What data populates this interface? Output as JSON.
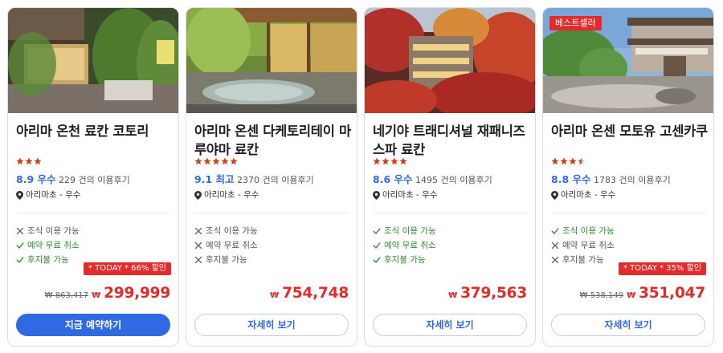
{
  "cards": [
    {
      "badge": "",
      "name": "아리마 온천 료칸 코토리",
      "stars": [
        1,
        1,
        1
      ],
      "score": "8.9 우수",
      "reviews": "229 건의 이용후기",
      "location": "아리마초 - 우수",
      "features": [
        {
          "text": "조식 이용 가능",
          "available": false
        },
        {
          "text": "예약 무료 취소",
          "available": true
        },
        {
          "text": "후지불 가능",
          "available": true
        }
      ],
      "promo": "* TODAY * 66% 할인",
      "old_price": "₩ 863,417",
      "currency": "₩",
      "price": "299,999",
      "button": "지금 예약하기",
      "button_style": "primary"
    },
    {
      "badge": "",
      "name": "아리마 온센 다케토리테이 마루야마 료칸",
      "stars": [
        1,
        1,
        1,
        1,
        1
      ],
      "score": "9.1 최고",
      "reviews": "2370 건의 이용후기",
      "location": "아리마초 - 우수",
      "features": [
        {
          "text": "조식 이용 가능",
          "available": false
        },
        {
          "text": "예약 무료 취소",
          "available": false
        },
        {
          "text": "후지불 가능",
          "available": false
        }
      ],
      "promo": "",
      "old_price": "",
      "currency": "₩",
      "price": "754,748",
      "button": "자세히 보기",
      "button_style": "secondary"
    },
    {
      "badge": "",
      "name": "네기야 트래디셔널 재패니즈 스파 료칸",
      "stars": [
        1,
        1,
        1,
        1
      ],
      "score": "8.6 우수",
      "reviews": "1495 건의 이용후기",
      "location": "아리마초 - 우수",
      "features": [
        {
          "text": "조식 이용 가능",
          "available": true
        },
        {
          "text": "예약 무료 취소",
          "available": true
        },
        {
          "text": "후지불 가능",
          "available": true
        }
      ],
      "promo": "",
      "old_price": "",
      "currency": "₩",
      "price": "379,563",
      "button": "자세히 보기",
      "button_style": "secondary"
    },
    {
      "badge": "베스트셀러",
      "name": "아리마 온센 모토유 고센카쿠",
      "stars": [
        1,
        1,
        1,
        0.5
      ],
      "score": "8.8 우수",
      "reviews": "1783 건의 이용후기",
      "location": "아리마초 - 우수",
      "features": [
        {
          "text": "조식 이용 가능",
          "available": true
        },
        {
          "text": "예약 무료 취소",
          "available": false
        },
        {
          "text": "후지불 가능",
          "available": false
        }
      ],
      "promo": "* TODAY * 35% 할인",
      "old_price": "₩ 538,149",
      "currency": "₩",
      "price": "351,047",
      "button": "자세히 보기",
      "button_style": "secondary"
    }
  ],
  "colors": {
    "accent": "#2f6ae3",
    "sale_red": "#e22b2b",
    "star": "#c0461b",
    "available_green": "#2f8a2f"
  },
  "icons": {
    "location": "map-pin-icon",
    "available": "checkmark-icon",
    "unavailable": "cross-icon",
    "star": "star-icon"
  }
}
